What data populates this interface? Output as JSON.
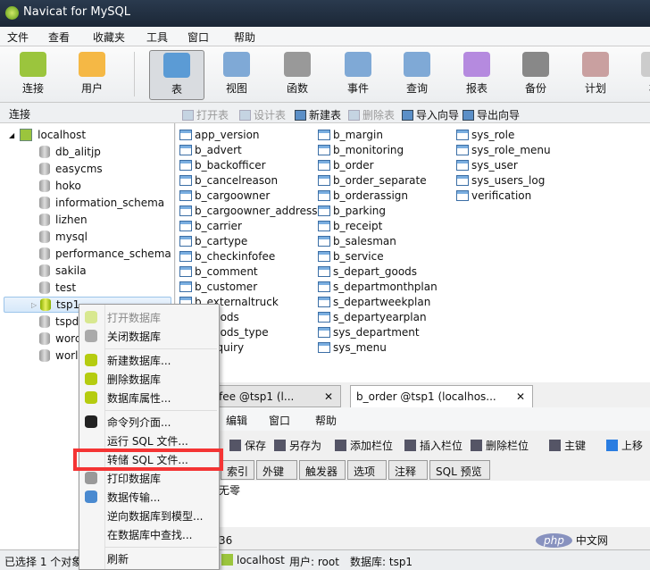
{
  "window": {
    "title": "Navicat for MySQL"
  },
  "menu": [
    "文件",
    "查看",
    "收藏夹",
    "工具",
    "窗口",
    "帮助"
  ],
  "toolbar": [
    {
      "label": "连接",
      "icon": "connection-icon",
      "color": "#9bc53d"
    },
    {
      "label": "用户",
      "icon": "user-icon",
      "color": "#f5b845"
    },
    {
      "label": "表",
      "icon": "table-icon",
      "color": "#5b9bd5",
      "active": true
    },
    {
      "label": "视图",
      "icon": "view-icon",
      "color": "#7fa9d6"
    },
    {
      "label": "函数",
      "icon": "function-icon",
      "color": "#999999"
    },
    {
      "label": "事件",
      "icon": "event-icon",
      "color": "#7fa9d6"
    },
    {
      "label": "查询",
      "icon": "query-icon",
      "color": "#7fa9d6"
    },
    {
      "label": "报表",
      "icon": "report-icon",
      "color": "#b58adf"
    },
    {
      "label": "备份",
      "icon": "backup-icon",
      "color": "#888888"
    },
    {
      "label": "计划",
      "icon": "schedule-icon",
      "color": "#c9a0a0"
    },
    {
      "label": "模",
      "icon": "model-icon",
      "color": "#cccccc"
    }
  ],
  "sidebar": {
    "header": "连接",
    "connection": "localhost",
    "databases": [
      "db_alitjp",
      "easycms",
      "hoko",
      "information_schema",
      "lizhen",
      "mysql",
      "performance_schema",
      "sakila",
      "test",
      "tsp1",
      "tspd",
      "worc",
      "worl"
    ],
    "selected": "tsp1"
  },
  "table_toolbar": [
    {
      "label": "打开表",
      "enabled": false
    },
    {
      "label": "设计表",
      "enabled": false
    },
    {
      "label": "新建表",
      "enabled": true
    },
    {
      "label": "删除表",
      "enabled": false
    },
    {
      "label": "导入向导",
      "enabled": true
    },
    {
      "label": "导出向导",
      "enabled": true
    }
  ],
  "tables": [
    [
      "app_version",
      "b_advert",
      "b_backofficer",
      "b_cancelreason",
      "b_cargoowner",
      "b_cargoowner_address",
      "b_carrier",
      "b_cartype",
      "b_checkinfofee",
      "b_comment",
      "b_customer",
      "b_externaltruck",
      "b_goods",
      "b_goods_type",
      "b_inquiry"
    ],
    [
      "b_margin",
      "b_monitoring",
      "b_order",
      "b_order_separate",
      "b_orderassign",
      "b_parking",
      "b_receipt",
      "b_salesman",
      "b_service",
      "s_depart_goods",
      "s_departmonthplan",
      "s_departweekplan",
      "s_departyearplan",
      "sys_department",
      "sys_menu"
    ],
    [
      "sys_role",
      "sys_role_menu",
      "sys_user",
      "sys_users_log",
      "verification"
    ]
  ],
  "editor": {
    "tabs": [
      {
        "label": "heckinfofee @tsp1 (l...",
        "close": "✕"
      },
      {
        "label": "b_order @tsp1 (localhos...",
        "close": "✕"
      }
    ],
    "menu": [
      "编辑",
      "窗口",
      "帮助"
    ],
    "toolbar": [
      "保存",
      "另存为",
      "添加栏位",
      "插入栏位",
      "删除栏位",
      "主键",
      "上移"
    ],
    "panel_tabs": [
      "索引",
      "外键",
      "触发器",
      "选项",
      "注释",
      "SQL 预览"
    ],
    "content_text": "无零",
    "status_text": "36"
  },
  "context_menu": {
    "items": [
      {
        "label": "打开数据库",
        "enabled": false,
        "icon": "open-db-icon"
      },
      {
        "label": "关闭数据库",
        "icon": "close-db-icon"
      },
      {
        "sep": true
      },
      {
        "label": "新建数据库...",
        "icon": "new-db-icon"
      },
      {
        "label": "删除数据库",
        "icon": "delete-db-icon"
      },
      {
        "label": "数据库属性...",
        "icon": "db-properties-icon"
      },
      {
        "sep": true
      },
      {
        "label": "命令列介面...",
        "icon": "console-icon"
      },
      {
        "label": "运行 SQL 文件...",
        "icon": ""
      },
      {
        "label": "转储 SQL 文件...",
        "icon": "",
        "highlighted": true
      },
      {
        "label": "打印数据库",
        "icon": "print-icon"
      },
      {
        "label": "数据传输...",
        "icon": "transfer-icon"
      },
      {
        "label": "逆向数据库到模型...",
        "icon": ""
      },
      {
        "label": "在数据库中查找...",
        "icon": ""
      },
      {
        "sep": true
      },
      {
        "label": "刷新",
        "icon": ""
      }
    ],
    "highlight_color": "#f43434"
  },
  "status": {
    "selection": "已选择 1 个对象",
    "connection": "localhost",
    "user": "用户: root",
    "database": "数据库: tsp1"
  },
  "watermark": {
    "php": "php",
    "text": "中文网"
  }
}
